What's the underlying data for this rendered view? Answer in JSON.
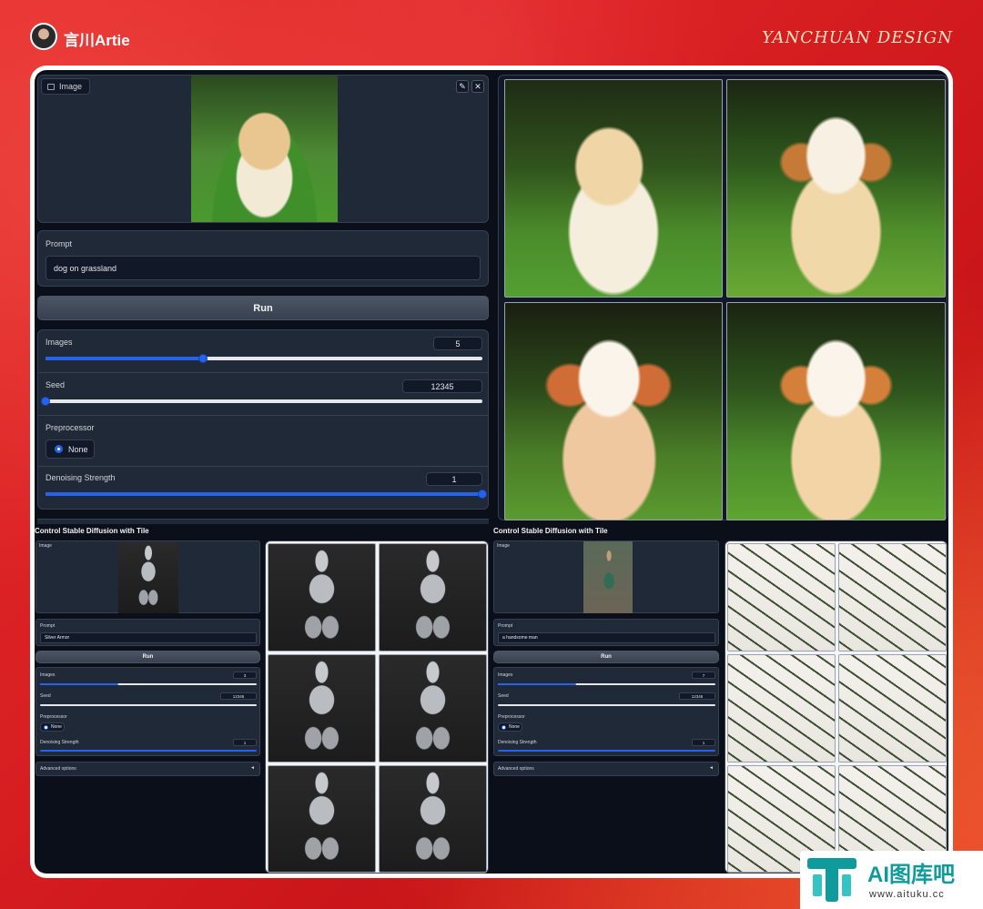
{
  "header": {
    "author": "言川Artie",
    "brand": "YANCHUAN DESIGN"
  },
  "main": {
    "image_tag": "Image",
    "edit_icon": "pencil-icon",
    "close_icon": "close-icon",
    "prompt_label": "Prompt",
    "prompt_value": "dog on grassland",
    "run_label": "Run",
    "images_label": "Images",
    "images_value": "5",
    "images_fraction": 0.36,
    "seed_label": "Seed",
    "seed_value": "12345",
    "seed_fraction": 0.0,
    "preprocessor_label": "Preprocessor",
    "preprocessor_option": "None",
    "denoise_label": "Denoising Strength",
    "denoise_value": "1",
    "denoise_fraction": 1.0
  },
  "demo_left": {
    "title": "Control Stable Diffusion with Tile",
    "image_tag": "Image",
    "prompt_label": "Prompt",
    "prompt_value": "Silver Armor",
    "run_label": "Run",
    "images_label": "Images",
    "images_value": "3",
    "images_fraction": 0.36,
    "seed_label": "Seed",
    "seed_value": "12345",
    "preprocessor_label": "Preprocessor",
    "preprocessor_option": "None",
    "denoise_label": "Denoising Strength",
    "denoise_value": "1",
    "advanced_label": "Advanced options"
  },
  "demo_right": {
    "title": "Control Stable Diffusion with Tile",
    "image_tag": "Image",
    "prompt_label": "Prompt",
    "prompt_value": "a handsome man",
    "run_label": "Run",
    "images_label": "Images",
    "images_value": "7",
    "images_fraction": 0.36,
    "seed_label": "Seed",
    "seed_value": "12345",
    "preprocessor_label": "Preprocessor",
    "preprocessor_option": "None",
    "denoise_label": "Denoising Strength",
    "denoise_value": "1",
    "advanced_label": "Advanced options"
  },
  "watermark": {
    "title": "AI图库吧",
    "url": "www.aituku.cc"
  }
}
